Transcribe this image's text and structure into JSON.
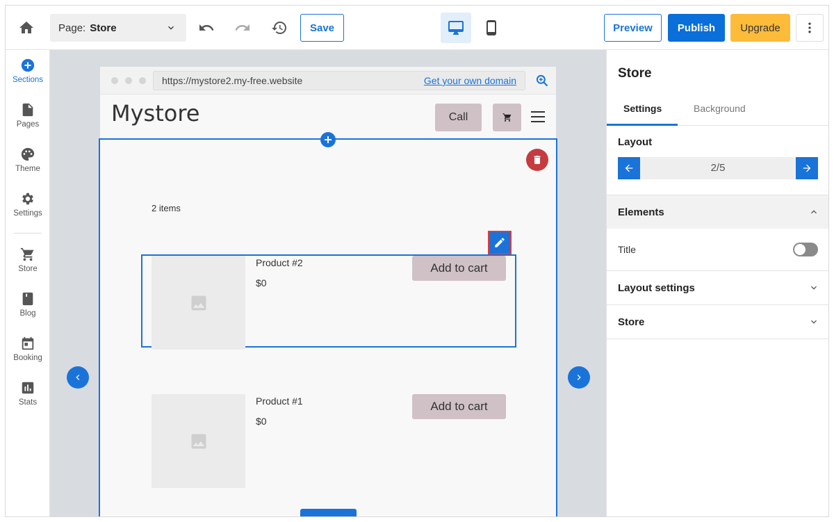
{
  "topbar": {
    "page_label": "Page:",
    "page_value": "Store",
    "save_label": "Save",
    "preview_label": "Preview",
    "publish_label": "Publish",
    "upgrade_label": "Upgrade"
  },
  "sidebar": {
    "items": [
      {
        "label": "Sections",
        "icon": "plus-circle-icon"
      },
      {
        "label": "Pages",
        "icon": "page-icon"
      },
      {
        "label": "Theme",
        "icon": "palette-icon"
      },
      {
        "label": "Settings",
        "icon": "gear-icon"
      },
      {
        "label": "Store",
        "icon": "cart-icon"
      },
      {
        "label": "Blog",
        "icon": "book-icon"
      },
      {
        "label": "Booking",
        "icon": "calendar-icon"
      },
      {
        "label": "Stats",
        "icon": "chart-icon"
      }
    ]
  },
  "site": {
    "url": "https://mystore2.my-free.website",
    "domain_link": "Get your own domain",
    "logo": "Mystore",
    "call_label": "Call",
    "items_count": "2 items",
    "products": [
      {
        "name": "Product #2",
        "price": "$0",
        "cta": "Add to cart"
      },
      {
        "name": "Product #1",
        "price": "$0",
        "cta": "Add to cart"
      }
    ]
  },
  "panel": {
    "title": "Store",
    "tabs": [
      {
        "label": "Settings"
      },
      {
        "label": "Background"
      }
    ],
    "layout_label": "Layout",
    "layout_counter": "2/5",
    "elements_label": "Elements",
    "title_toggle_label": "Title",
    "title_toggle_on": false,
    "layout_settings_label": "Layout settings",
    "store_label": "Store"
  },
  "colors": {
    "accent": "#1a73d9",
    "publish": "#0a6fd8",
    "upgrade": "#fdbb3a",
    "delete": "#c63b3f",
    "button_muted": "#cfc1c5"
  }
}
